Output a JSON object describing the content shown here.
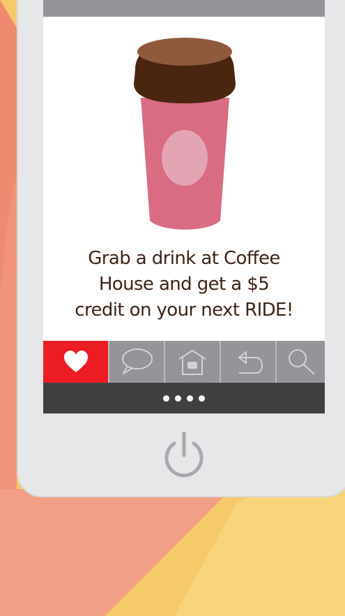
{
  "promo": {
    "line1": "Grab a drink at Coffee",
    "line2": "House and get a $5",
    "line3": "credit on your next RIDE!"
  },
  "nav": {
    "items": [
      {
        "icon": "heart-icon",
        "active": true
      },
      {
        "icon": "chat-bubble-icon",
        "active": false
      },
      {
        "icon": "home-icon",
        "active": false
      },
      {
        "icon": "back-arrow-icon",
        "active": false
      },
      {
        "icon": "search-icon",
        "active": false
      }
    ]
  },
  "pager": {
    "page_count": 4
  },
  "colors": {
    "background": "#f6c96a",
    "hand": "#f0957a",
    "phone_body": "#e6e7e8",
    "nav_active": "#ec1c24",
    "nav_bar": "#939598",
    "pager_bar": "#404041",
    "cup_body": "#d96b82",
    "cup_lid": "#4a2510",
    "text": "#3d2417"
  }
}
